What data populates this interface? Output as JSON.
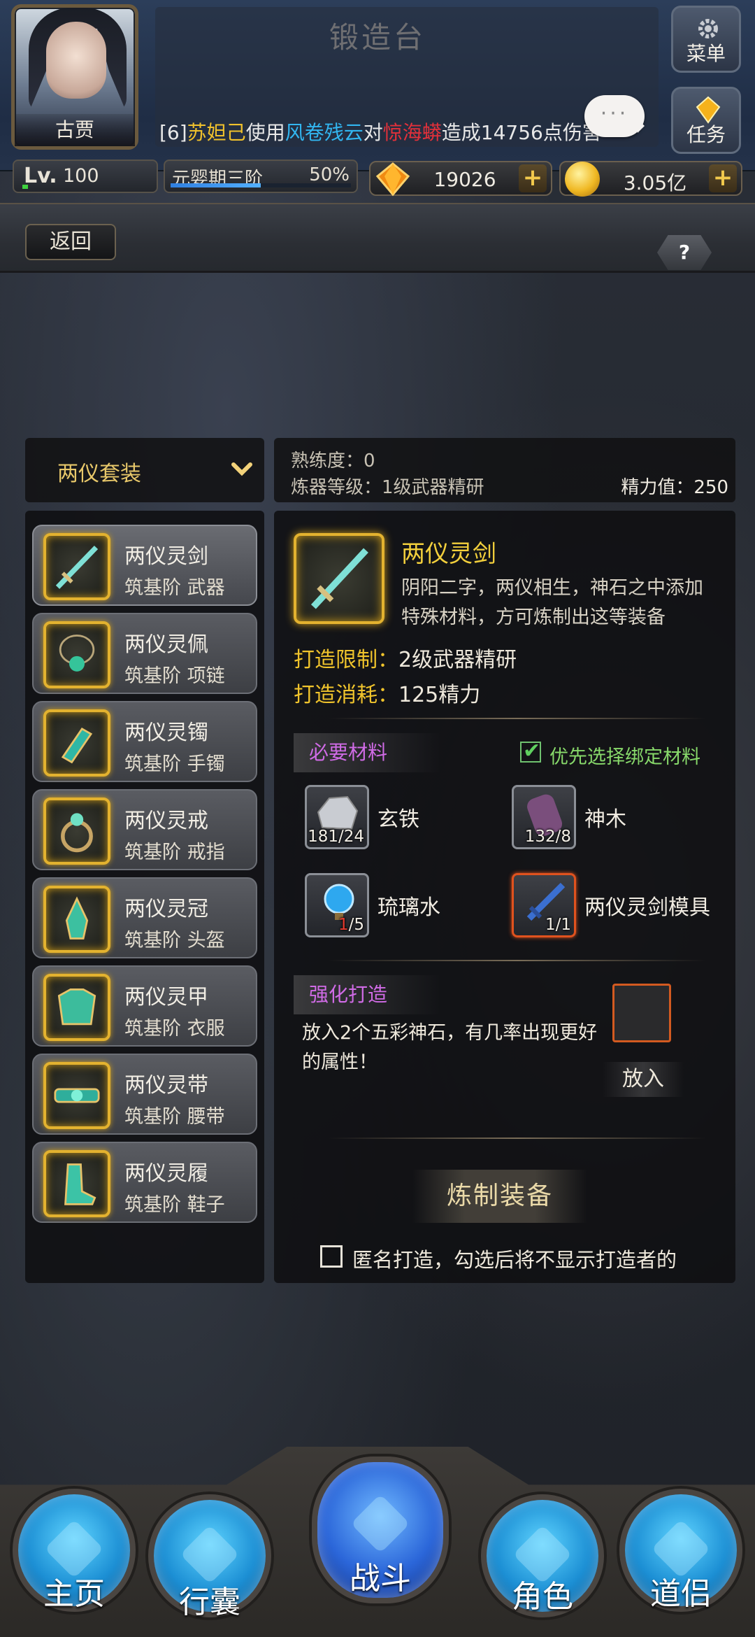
{
  "player": {
    "name": "古贾",
    "level_label": "Lv.",
    "level": "100"
  },
  "chat": {
    "prefix": "[6]",
    "actor": "苏妲己",
    "t1": "使用",
    "skill": "风卷残云",
    "t2": "对",
    "target": "惊海蟒",
    "t3": "造成14756点伤害"
  },
  "chat_bubble": "···",
  "top_buttons": {
    "menu": "菜单",
    "task": "任务"
  },
  "realm": {
    "label": "元婴期三阶",
    "percent_text": "50%",
    "progress": 0.5
  },
  "currencies": {
    "gems": "19026",
    "gold": "3.05亿",
    "plus": "+"
  },
  "forge": {
    "title": "锻造台",
    "back": "返回",
    "help": "?"
  },
  "set_select": {
    "label": "两仪套装"
  },
  "info": {
    "proficiency": "熟练度：0",
    "refiner_level": "炼器等级：1级武器精研",
    "energy": "精力值：250"
  },
  "items": [
    {
      "name": "两仪灵剑",
      "sub": "筑基阶 武器"
    },
    {
      "name": "两仪灵佩",
      "sub": "筑基阶 项链"
    },
    {
      "name": "两仪灵镯",
      "sub": "筑基阶 手镯"
    },
    {
      "name": "两仪灵戒",
      "sub": "筑基阶 戒指"
    },
    {
      "name": "两仪灵冠",
      "sub": "筑基阶 头盔"
    },
    {
      "name": "两仪灵甲",
      "sub": "筑基阶 衣服"
    },
    {
      "name": "两仪灵带",
      "sub": "筑基阶 腰带"
    },
    {
      "name": "两仪灵履",
      "sub": "筑基阶 鞋子"
    }
  ],
  "detail": {
    "name": "两仪灵剑",
    "desc": "阴阳二字，两仪相生，神石之中添加特殊材料，方可炼制出这等装备",
    "limit_key": "打造限制：",
    "limit_val": "2级武器精研",
    "cost_key": "打造消耗：",
    "cost_val": "125精力"
  },
  "materials_section": {
    "title": "必要材料",
    "prefer_bound": "优先选择绑定材料"
  },
  "materials": [
    {
      "name": "玄铁",
      "have": "181",
      "need": "/24"
    },
    {
      "name": "神木",
      "have": "132",
      "need": "/8"
    },
    {
      "name": "琉璃水",
      "have": "1",
      "need": "/5"
    },
    {
      "name": "两仪灵剑模具",
      "have": "1",
      "need": "/1"
    }
  ],
  "enhance": {
    "title": "强化打造",
    "desc": "放入2个五彩神石，有几率出现更好的属性！",
    "put": "放入"
  },
  "craft_button": "炼制装备",
  "anonymous": "匿名打造，勾选后将不显示打造者的",
  "nav": [
    "主页",
    "行囊",
    "战斗",
    "角色",
    "道侣"
  ],
  "colors": {
    "gold_text": "#f2cf3c",
    "purple_tag": "#d06be6",
    "red_count": "#e53a2e",
    "skill_cyan": "#32b6f0",
    "target_red": "#e2303a"
  }
}
